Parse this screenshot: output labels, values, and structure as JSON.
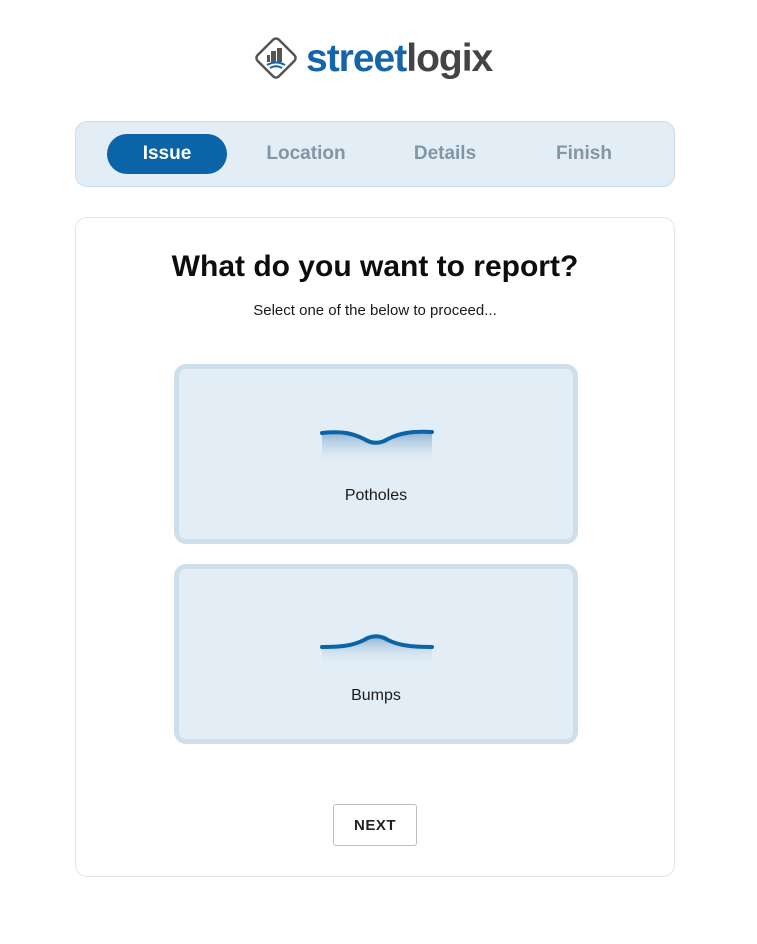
{
  "brand": {
    "name_part1": "street",
    "name_part2": "logix",
    "colors": {
      "primary": "#1565a8",
      "secondary": "#444444"
    }
  },
  "stepper": {
    "steps": [
      {
        "label": "Issue",
        "active": true
      },
      {
        "label": "Location",
        "active": false
      },
      {
        "label": "Details",
        "active": false
      },
      {
        "label": "Finish",
        "active": false
      }
    ]
  },
  "form": {
    "title": "What do you want to report?",
    "subtitle": "Select one of the below to proceed...",
    "options": [
      {
        "label": "Potholes",
        "icon": "pothole-icon"
      },
      {
        "label": "Bumps",
        "icon": "bump-icon"
      }
    ],
    "next_label": "NEXT"
  },
  "colors": {
    "accent": "#0b63a8",
    "panel_bg": "#e3edf5",
    "panel_border": "#cddfeb",
    "step_inactive": "#8396a6"
  }
}
